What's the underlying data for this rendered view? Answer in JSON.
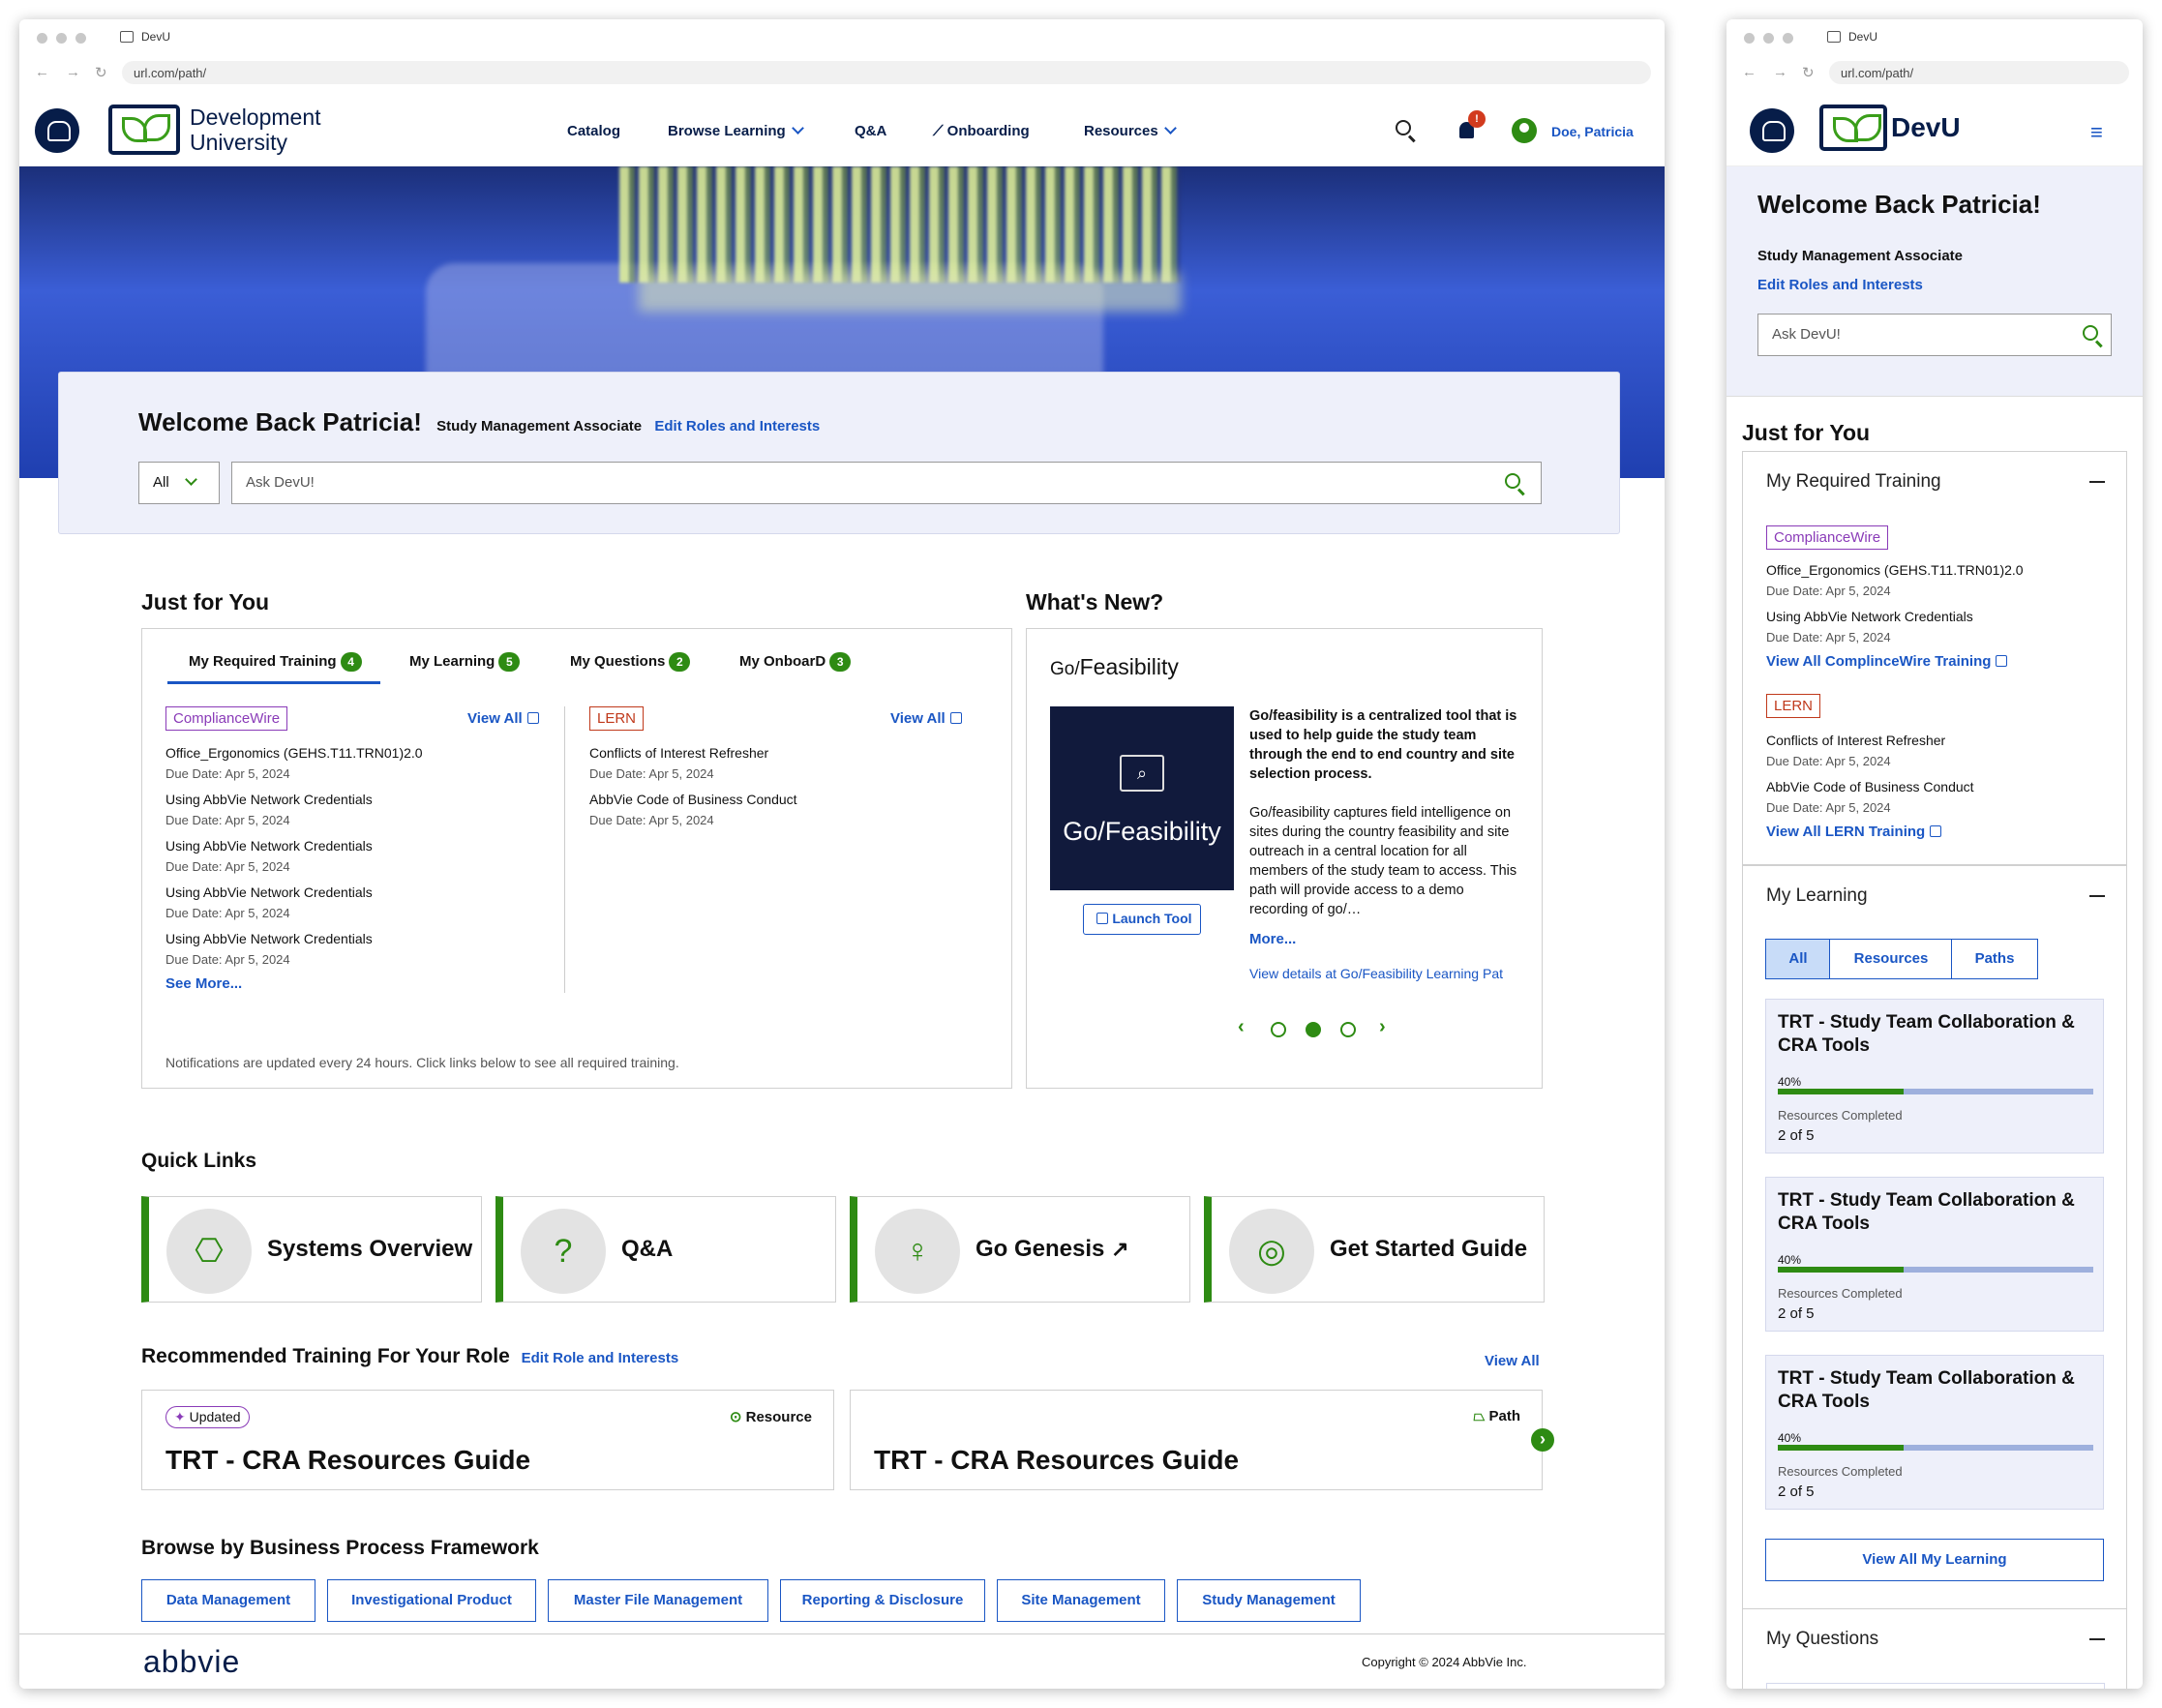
{
  "browser": {
    "tab_title": "DevU",
    "url": "url.com/path/"
  },
  "brand": {
    "name_line1": "Development",
    "name_line2": "University",
    "short_name": "DevU",
    "green": "#2e8b13",
    "navy": "#071d49",
    "link_blue": "#1a56c4"
  },
  "nav": {
    "catalog": "Catalog",
    "browse": "Browse Learning",
    "qa": "Q&A",
    "onboarding": "Onboarding",
    "resources": "Resources",
    "user": "Doe, Patricia",
    "notif_count": "!"
  },
  "welcome": {
    "title": "Welcome Back Patricia!",
    "role": "Study Management Associate",
    "edit_link": "Edit Roles and Interests",
    "filter_value": "All",
    "search_placeholder": "Ask DevU!"
  },
  "jfy": {
    "heading": "Just for You",
    "tabs": [
      {
        "label": "My Required Training",
        "count": "4"
      },
      {
        "label": "My Learning",
        "count": "5"
      },
      {
        "label": "My Questions",
        "count": "2"
      },
      {
        "label": "My OnboarD",
        "count": "3"
      }
    ],
    "cw": {
      "tag": "ComplianceWire",
      "view_all": "View All",
      "items": [
        {
          "title": "Office_Ergonomics (GEHS.T11.TRN01)2.0",
          "due": "Due Date: Apr 5, 2024"
        },
        {
          "title": "Using AbbVie Network Credentials",
          "due": "Due Date: Apr 5, 2024"
        },
        {
          "title": "Using AbbVie Network Credentials",
          "due": "Due Date: Apr 5, 2024"
        },
        {
          "title": "Using AbbVie Network Credentials",
          "due": "Due Date: Apr 5, 2024"
        },
        {
          "title": "Using AbbVie Network Credentials",
          "due": "Due Date: Apr 5, 2024"
        }
      ],
      "see_more": "See More..."
    },
    "lern": {
      "tag": "LERN",
      "view_all": "View All",
      "items": [
        {
          "title": "Conflicts of Interest Refresher",
          "due": "Due Date: Apr 5, 2024"
        },
        {
          "title": "AbbVie Code of Business Conduct",
          "due": "Due Date: Apr 5, 2024"
        }
      ]
    },
    "note": "Notifications are updated every 24 hours. Click links below to see all required training."
  },
  "whats_new": {
    "heading": "What's New?",
    "title_prefix": "Go/",
    "title_rest": "Feasibility",
    "tile_label": "Go/Feasibility",
    "launch": "Launch Tool",
    "desc_bold": "Go/feasibility is a centralized tool that is used to help guide the study team through the end to end country and site selection process.",
    "desc": "Go/feasibility captures field intelligence on sites during the country feasibility and site outreach in a central location for all members of the study team to access. This path will provide access to a demo recording of go/…",
    "more": "More...",
    "details": "View details at Go/Feasibility Learning Pat",
    "prev": "‹",
    "next": "›"
  },
  "quick_links": {
    "heading": "Quick Links",
    "items": [
      {
        "label": "Systems Overview",
        "icon": "network-icon"
      },
      {
        "label": "Q&A",
        "icon": "chat-question-icon"
      },
      {
        "label": "Go Genesis",
        "icon": "lightbulb-icon"
      },
      {
        "label": "Get Started Guide",
        "icon": "target-icon"
      }
    ]
  },
  "recommended": {
    "heading": "Recommended Training For Your Role",
    "edit": "Edit Role and Interests",
    "view_all": "View All",
    "cards": [
      {
        "badge": "Updated",
        "type": "Resource",
        "title": "TRT - CRA Resources Guide"
      },
      {
        "type": "Path",
        "title": "TRT - CRA Resources Guide"
      }
    ]
  },
  "bpf": {
    "heading": "Browse by Business Process Framework",
    "items": [
      "Data Management",
      "Investigational Product",
      "Master File Management",
      "Reporting & Disclosure",
      "Site Management",
      "Study Management"
    ]
  },
  "footer": {
    "logo": "abbvie",
    "copyright": "Copyright © 2024 AbbVie Inc."
  },
  "mobile": {
    "just_for_you": "Just for You",
    "required_heading": "My Required Training",
    "cw_items": [
      {
        "title": "Office_Ergonomics (GEHS.T11.TRN01)2.0",
        "due": "Due Date: Apr 5, 2024"
      },
      {
        "title": "Using AbbVie Network Credentials",
        "due": "Due Date: Apr 5, 2024"
      }
    ],
    "cw_view_all": "View All ComplinceWire Training",
    "lern_items": [
      {
        "title": "Conflicts of Interest Refresher",
        "due": "Due Date: Apr 5, 2024"
      },
      {
        "title": "AbbVie Code of Business Conduct",
        "due": "Due Date: Apr 5, 2024"
      }
    ],
    "lern_view_all": "View All LERN Training",
    "learning_heading": "My Learning",
    "segments": [
      "All",
      "Resources",
      "Paths"
    ],
    "learning_cards": [
      {
        "title": "TRT - Study Team Collaboration & CRA Tools",
        "progress_label": "40%",
        "progress": 0.4,
        "resources_label": "Resources Completed",
        "resources_value": "2 of 5"
      },
      {
        "title": "TRT - Study Team Collaboration & CRA Tools",
        "progress_label": "40%",
        "progress": 0.4,
        "resources_label": "Resources Completed",
        "resources_value": "2 of 5"
      },
      {
        "title": "TRT - Study Team Collaboration & CRA Tools",
        "progress_label": "40%",
        "progress": 0.4,
        "resources_label": "Resources Completed",
        "resources_value": "2 of 5"
      }
    ],
    "view_all_learning": "View All My Learning",
    "questions_heading": "My Questions"
  }
}
